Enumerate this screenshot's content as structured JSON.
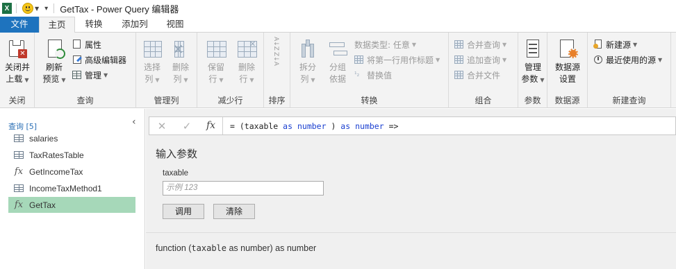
{
  "window": {
    "title": "GetTax - Power Query 编辑器",
    "app_icon": "excel-icon"
  },
  "tabs": [
    {
      "label": "文件"
    },
    {
      "label": "主页"
    },
    {
      "label": "转换"
    },
    {
      "label": "添加列"
    },
    {
      "label": "视图"
    }
  ],
  "ribbon": {
    "close": {
      "label_line1": "关闭并",
      "label_line2": "上载",
      "group": "关闭"
    },
    "query": {
      "refresh_line1": "刷新",
      "refresh_line2": "预览",
      "properties": "属性",
      "advanced_editor": "高级编辑器",
      "manage": "管理",
      "group": "查询"
    },
    "columns": {
      "select_line1": "选择",
      "select_line2": "列",
      "remove_line1": "删除",
      "remove_line2": "列",
      "group": "管理列"
    },
    "rows": {
      "keep_line1": "保留",
      "keep_line2": "行",
      "remove_line1": "删除",
      "remove_line2": "行",
      "group": "减少行"
    },
    "sort": {
      "asc": "A↓Z",
      "desc": "Z↓A",
      "group": "排序"
    },
    "transform": {
      "split_line1": "拆分",
      "split_line2": "列",
      "groupby_line1": "分组",
      "groupby_line2": "依据",
      "datatype": "数据类型: 任意",
      "first_row_header": "将第一行用作标题",
      "replace_values": "替换值",
      "group": "转换"
    },
    "combine": {
      "merge": "合并查询",
      "append": "追加查询",
      "combine_files": "合并文件",
      "group": "组合"
    },
    "parameters": {
      "manage_line1": "管理",
      "manage_line2": "参数",
      "group": "参数"
    },
    "datasource": {
      "settings_line1": "数据源",
      "settings_line2": "设置",
      "group": "数据源"
    },
    "newquery": {
      "new_source": "新建源",
      "recent_sources": "最近使用的源",
      "group": "新建查询"
    }
  },
  "queries_pane": {
    "header": "查询 [5]",
    "collapse_icon": "chevron-left-icon",
    "items": [
      {
        "name": "salaries",
        "icon": "table-icon"
      },
      {
        "name": "TaxRatesTable",
        "icon": "table-icon"
      },
      {
        "name": "GetIncomeTax",
        "icon": "function-icon"
      },
      {
        "name": "IncomeTaxMethod1",
        "icon": "table-icon"
      },
      {
        "name": "GetTax",
        "icon": "function-icon",
        "selected": true
      }
    ]
  },
  "formula_bar": {
    "cancel": "✕",
    "commit": "✓",
    "fx": "fx",
    "formula_prefix": "= (taxable ",
    "kw1": "as",
    "kw2": "number",
    "mid": " ) ",
    "kw3": "as",
    "kw4": "number",
    "suffix": " =>"
  },
  "invoke": {
    "title": "输入参数",
    "param_label": "taxable",
    "param_placeholder": "示例 123",
    "invoke_button": "调用",
    "clear_button": "清除",
    "signature_prefix": "function (",
    "signature_param": "taxable",
    "signature_suffix": " as number) as number"
  },
  "colors": {
    "file_tab": "#1e73be",
    "selected_query": "#a6d8b9",
    "keyword": "#1a3fd0",
    "excel_green": "#1e7145"
  }
}
